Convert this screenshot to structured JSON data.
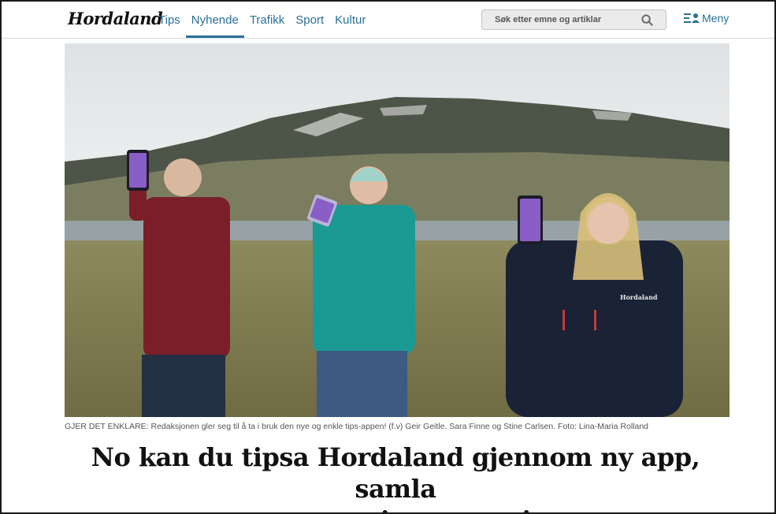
{
  "header": {
    "logo": "Hordaland",
    "nav": [
      {
        "label": "Tips"
      },
      {
        "label": "Nyhende"
      },
      {
        "label": "Trafikk"
      },
      {
        "label": "Sport"
      },
      {
        "label": "Kultur"
      }
    ],
    "active_nav": "Nyhende",
    "search_placeholder": "Søk etter emne og artiklar",
    "menu_label": "Meny"
  },
  "article": {
    "phone_brand": "Hordaland",
    "caption": "GJER DET ENKLARE: Redaksjonen gler seg til å ta i bruk den nye og enkle tips-appen! (f.v) Geir Geitle, Sara Finne og Stine Carlsen. Foto: Lina-Maria Rolland",
    "headline_line1": "No kan du tipsa Hordaland gjennom ny app, samla",
    "headline_line2": "poeng og vinna premiar"
  },
  "colors": {
    "accent": "#2a6f97",
    "text": "#111111",
    "caption": "#555555"
  }
}
